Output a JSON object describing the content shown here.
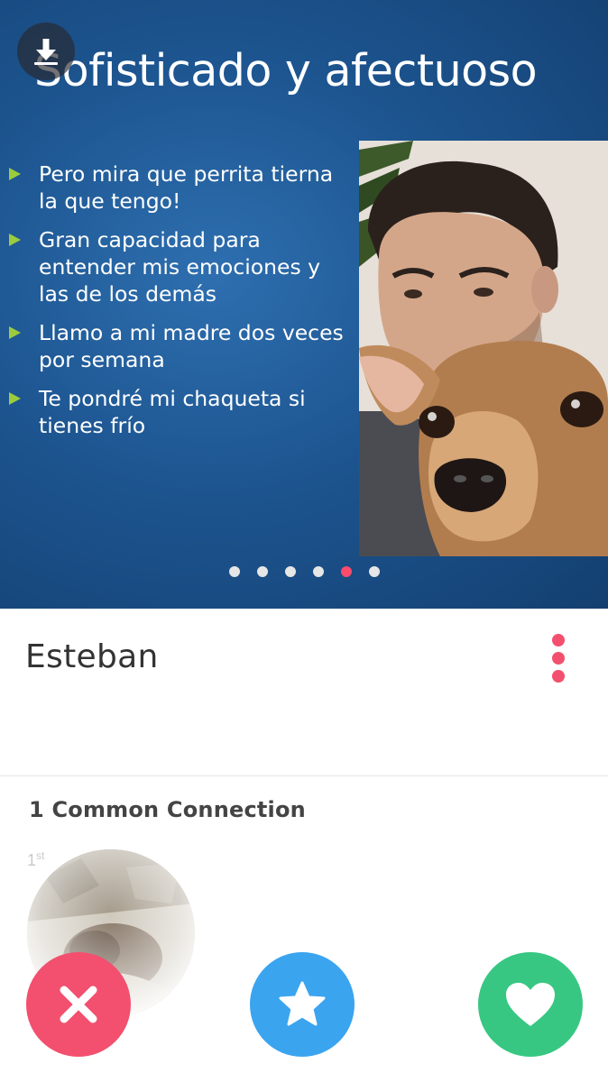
{
  "slide": {
    "title": "Sofisticado y afectuoso",
    "bullets": [
      "Pero mira que perrita tierna la que tengo!",
      "Gran capacidad para entender mis emociones y las de los demás",
      "Llamo a mi madre dos veces por semana",
      "Te pondré mi chaqueta si tienes frío"
    ],
    "photo_icon": "photo-man-with-dog",
    "pagination": {
      "total": 6,
      "active_index": 4
    }
  },
  "profile": {
    "name": "Esteban",
    "more_icon": "vertical-dots-icon"
  },
  "connections": {
    "title": "1 Common Connection",
    "items": [
      {
        "degree": "1",
        "degree_suffix": "st",
        "avatar": "avatar-icon"
      }
    ]
  },
  "actions": {
    "nope_icon": "close-icon",
    "superlike_icon": "star-icon",
    "like_icon": "heart-icon"
  },
  "colors": {
    "accent_red": "#f2506e",
    "accent_blue": "#3ba4ef",
    "accent_green": "#37c782",
    "active_dot": "#fd4b6c",
    "bullet_green": "#9ccc3c"
  }
}
